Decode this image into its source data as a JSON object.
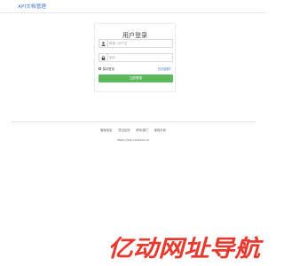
{
  "header": {
    "brand": "API文档管理"
  },
  "login": {
    "title": "用户登录",
    "username_placeholder": "邮箱 / 用户名",
    "username_value": "",
    "password_placeholder": "密码",
    "password_value": "",
    "remember_label": "保持登录",
    "forgot_label": "忘记密码?",
    "submit_label": "立即登录"
  },
  "footer": {
    "links": [
      "备案信息",
      "意见反馈",
      "联系我们",
      "使用手册"
    ],
    "url": "https://api.xxxxxxx.cn"
  },
  "watermark": {
    "text": "亿动网址导航"
  },
  "colors": {
    "accent": "#3a74c8",
    "button": "#5cb85c",
    "watermark": "#e63a2e"
  }
}
